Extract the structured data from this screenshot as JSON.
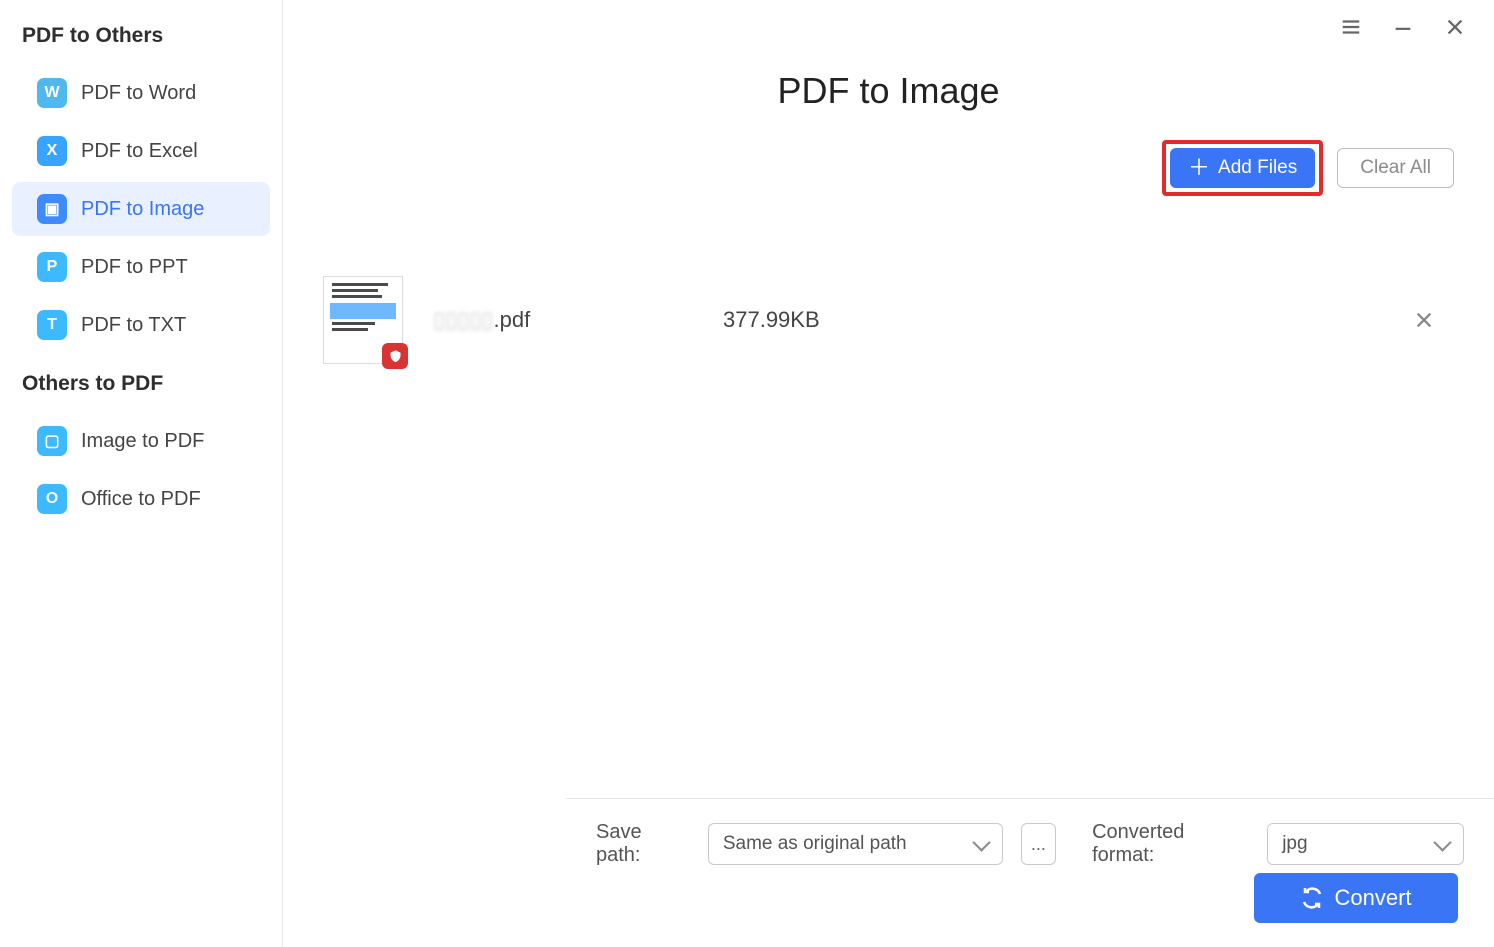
{
  "window": {
    "menu": "☰",
    "min": "–",
    "close": "✕"
  },
  "sidebar": {
    "sections": {
      "pdf_to_others": "PDF to Others",
      "others_to_pdf": "Others to PDF"
    },
    "items": {
      "pdf_to_word": {
        "label": "PDF to Word",
        "icon": "W"
      },
      "pdf_to_excel": {
        "label": "PDF to Excel",
        "icon": "X"
      },
      "pdf_to_image": {
        "label": "PDF to Image",
        "icon": "▣"
      },
      "pdf_to_ppt": {
        "label": "PDF to PPT",
        "icon": "P"
      },
      "pdf_to_txt": {
        "label": "PDF to TXT",
        "icon": "T"
      },
      "image_to_pdf": {
        "label": "Image to PDF",
        "icon": "▢"
      },
      "office_to_pdf": {
        "label": "Office to PDF",
        "icon": "O"
      }
    }
  },
  "page": {
    "title": "PDF to Image",
    "add_files": "Add Files",
    "clear_all": "Clear All"
  },
  "files": [
    {
      "name_prefix": "▯▯▯▯▯",
      "ext": ".pdf",
      "size": "377.99KB"
    }
  ],
  "bottom": {
    "save_path_label": "Save path:",
    "save_path_value": "Same as original path",
    "browse": "...",
    "format_label": "Converted format:",
    "format_value": "jpg",
    "convert": "Convert"
  }
}
